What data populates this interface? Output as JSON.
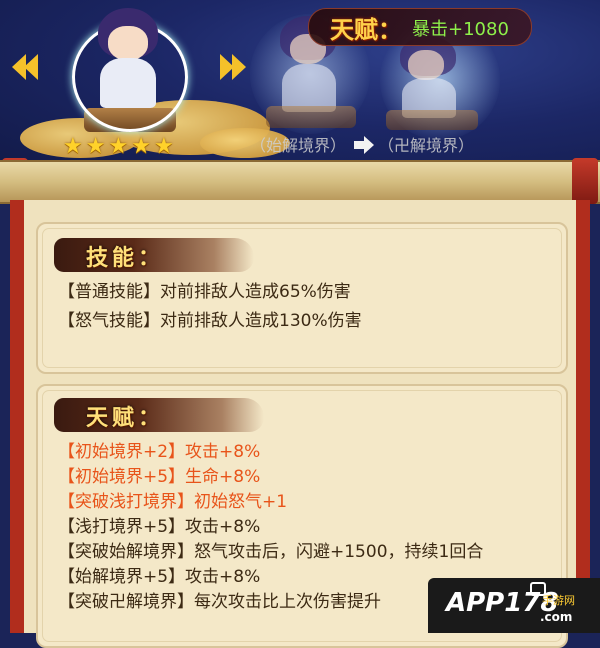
{
  "talent_header": {
    "title": "天赋：",
    "bonus": "暴击+1080"
  },
  "stages": {
    "from": "（始解境界）",
    "to": "（卍解境界）"
  },
  "hero": {
    "stars": 5
  },
  "skills": {
    "title": "技能：",
    "items": [
      "【普通技能】对前排敌人造成65%伤害",
      "【怒气技能】对前排敌人造成130%伤害"
    ]
  },
  "talents": {
    "title": "天赋：",
    "items": [
      {
        "text": "【初始境界+2】攻击+8%",
        "color": "#e8541a"
      },
      {
        "text": "【初始境界+5】生命+8%",
        "color": "#e8541a"
      },
      {
        "text": "【突破浅打境界】初始怒气+1",
        "color": "#e8541a"
      },
      {
        "text": "【浅打境界+5】攻击+8%",
        "color": "#3c2a14"
      },
      {
        "text": "【突破始解境界】怒气攻击后，闪避+1500，持续1回合",
        "color": "#3c2a14"
      },
      {
        "text": "【始解境界+5】攻击+8%",
        "color": "#3c2a14"
      },
      {
        "text": "【突破卍解境界】每次攻击比上次伤害提升",
        "color": "#3c2a14"
      }
    ]
  },
  "watermark": {
    "brand": "APP178",
    "sub": "手游网",
    "domain": ".com"
  }
}
